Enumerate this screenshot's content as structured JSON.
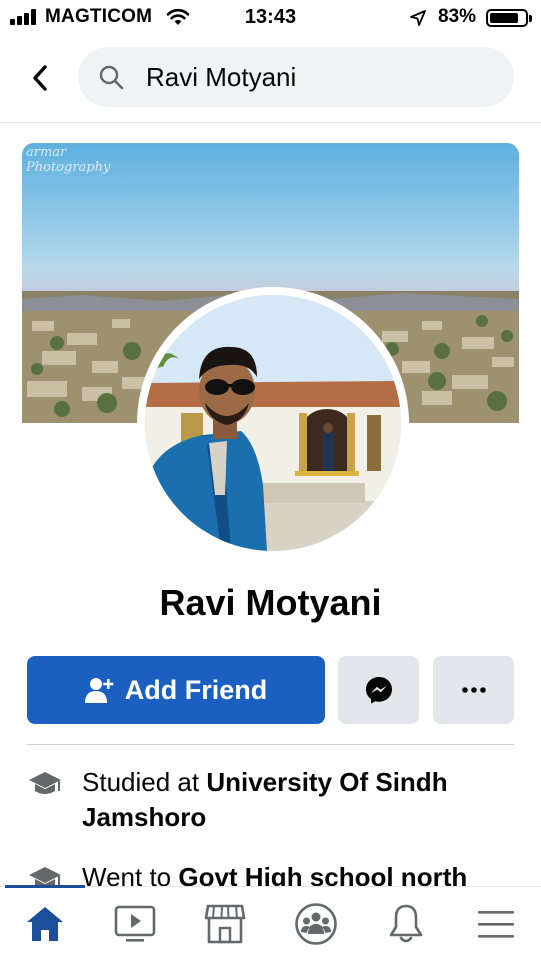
{
  "status_bar": {
    "carrier": "MAGTICOM",
    "time": "13:43",
    "battery": "83%",
    "battery_level": 0.83
  },
  "search": {
    "query": "Ravi Motyani"
  },
  "cover": {
    "watermark_line1": "armar",
    "watermark_line2": "Photography"
  },
  "profile": {
    "name": "Ravi Motyani"
  },
  "actions": {
    "add_friend": "Add Friend"
  },
  "intro": [
    {
      "prefix": "Studied at ",
      "place": "University Of Sindh Jamshoro",
      "icon": "graduation-cap-icon"
    },
    {
      "prefix": "Went to ",
      "place": "Govt High school north",
      "icon": "graduation-cap-icon"
    }
  ],
  "tab_bar": {
    "active": "home",
    "tabs": [
      {
        "id": "home",
        "icon": "home-icon"
      },
      {
        "id": "watch",
        "icon": "video-icon"
      },
      {
        "id": "marketplace",
        "icon": "marketplace-icon"
      },
      {
        "id": "groups",
        "icon": "groups-icon"
      },
      {
        "id": "notifications",
        "icon": "bell-icon"
      },
      {
        "id": "menu",
        "icon": "menu-icon"
      }
    ]
  },
  "colors": {
    "brand_blue": "#1b5fc1",
    "button_gray": "#e4e6eb",
    "search_bg": "#f0f2f5",
    "active_tab": "#1b4f9c"
  }
}
